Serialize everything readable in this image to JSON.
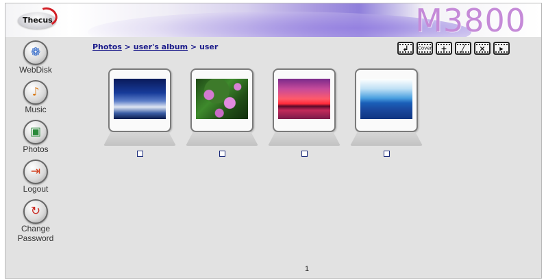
{
  "header": {
    "logo_text": "Thecus",
    "model": "M3800"
  },
  "sidebar": {
    "items": [
      {
        "label": "WebDisk",
        "icon": "globe-icon",
        "glyph": "❁"
      },
      {
        "label": "Music",
        "icon": "music-disc-icon",
        "glyph": "♪"
      },
      {
        "label": "Photos",
        "icon": "photo-icon",
        "glyph": "▣"
      },
      {
        "label": "Logout",
        "icon": "door-icon",
        "glyph": "⇥"
      },
      {
        "label": "Change Password",
        "label_line1": "Change",
        "label_line2": "Password",
        "icon": "lock-cycle-icon",
        "glyph": "↻"
      }
    ]
  },
  "breadcrumb": {
    "root": "Photos",
    "sep1": ">",
    "album": "user's album",
    "sep2": ">",
    "current": "user"
  },
  "toolbar": {
    "buttons": [
      {
        "name": "back-icon",
        "glyph": "↲"
      },
      {
        "name": "cover-icon",
        "glyph": "Cover"
      },
      {
        "name": "add-icon",
        "glyph": "+"
      },
      {
        "name": "edit-icon",
        "glyph": "╱"
      },
      {
        "name": "delete-icon",
        "glyph": "×"
      },
      {
        "name": "slideshow-icon",
        "glyph": "▸"
      }
    ]
  },
  "photos": [
    {
      "subject": "frozen-trees-thumbnail"
    },
    {
      "subject": "water-lilies-thumbnail"
    },
    {
      "subject": "sunset-thumbnail"
    },
    {
      "subject": "blue-hills-thumbnail"
    }
  ],
  "pagination": {
    "current_page": "1"
  }
}
